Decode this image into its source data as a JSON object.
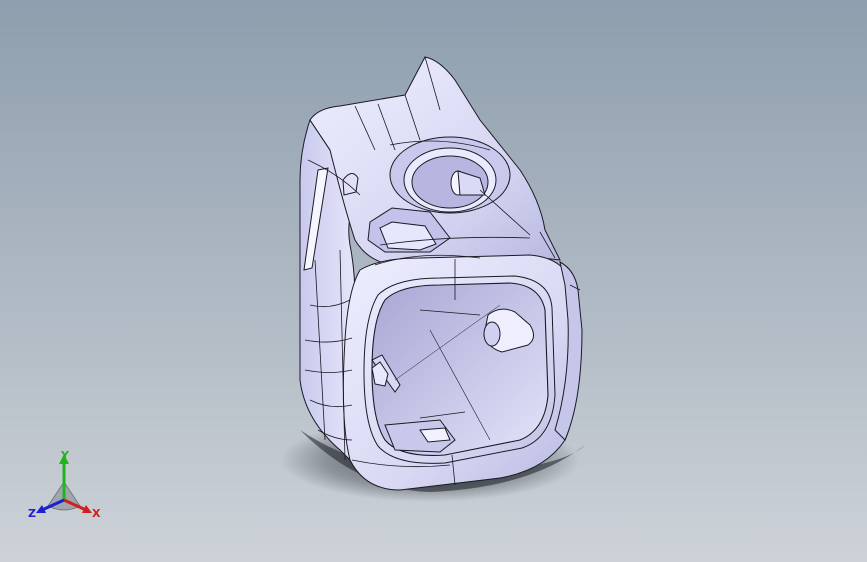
{
  "viewport": {
    "background_top": "#8e9eae",
    "background_bottom": "#cdd2d8"
  },
  "model": {
    "part_color": "#dcdcf6",
    "edge_color": "#1a1a24",
    "shadow_color": "#2a2f36"
  },
  "triad": {
    "x_label": "X",
    "y_label": "Y",
    "z_label": "Z",
    "x_color": "#d21e1e",
    "y_color": "#1eb41e",
    "z_color": "#1e1ed2"
  }
}
